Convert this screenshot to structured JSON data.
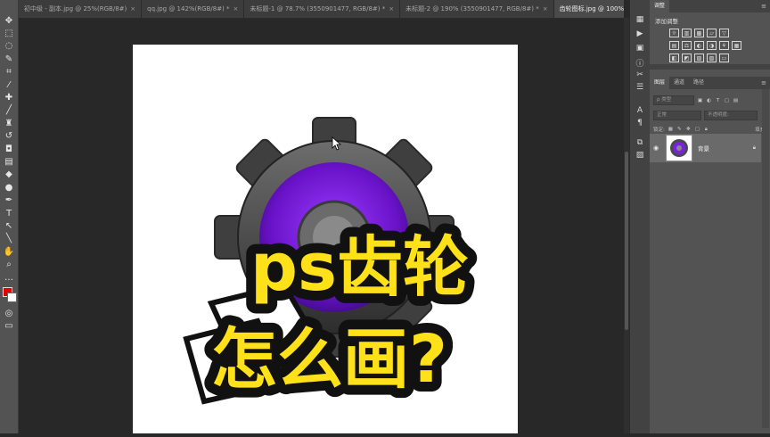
{
  "tabs": [
    {
      "label": "初中级 - 副本.jpg @ 25%(RGB/8#)",
      "active": false
    },
    {
      "label": "qq.jpg @ 142%(RGB/8#) *",
      "active": false
    },
    {
      "label": "未标题-1 @ 78.7% (3550901477, RGB/8#) *",
      "active": false
    },
    {
      "label": "未标题-2 @ 190% (3550901477, RGB/8#) *",
      "active": false
    },
    {
      "label": "齿轮图标.jpg @ 100%(RGB/8)",
      "active": true
    }
  ],
  "tools": [
    {
      "icon": "move-icon",
      "glyph": "✥"
    },
    {
      "icon": "marquee-icon",
      "glyph": "⬚"
    },
    {
      "icon": "lasso-icon",
      "glyph": "◌"
    },
    {
      "icon": "quick-select-icon",
      "glyph": "✎"
    },
    {
      "icon": "crop-icon",
      "glyph": "⌗"
    },
    {
      "icon": "eyedropper-icon",
      "glyph": "⁄"
    },
    {
      "icon": "healing-brush-icon",
      "glyph": "✚"
    },
    {
      "icon": "brush-icon",
      "glyph": "╱"
    },
    {
      "icon": "stamp-icon",
      "glyph": "♜"
    },
    {
      "icon": "history-brush-icon",
      "glyph": "↺"
    },
    {
      "icon": "eraser-icon",
      "glyph": "◘"
    },
    {
      "icon": "gradient-icon",
      "glyph": "▤"
    },
    {
      "icon": "blur-icon",
      "glyph": "◆"
    },
    {
      "icon": "dodge-icon",
      "glyph": "●"
    },
    {
      "icon": "pen-icon",
      "glyph": "✒"
    },
    {
      "icon": "type-icon",
      "glyph": "T"
    },
    {
      "icon": "path-select-icon",
      "glyph": "↖"
    },
    {
      "icon": "line-tool-icon",
      "glyph": "╲"
    },
    {
      "icon": "hand-icon",
      "glyph": "✋"
    },
    {
      "icon": "zoom-icon",
      "glyph": "⌕"
    },
    {
      "icon": "more-tools-icon",
      "glyph": "…"
    }
  ],
  "dock_icons": [
    {
      "icon": "color-panel-icon",
      "glyph": "▦"
    },
    {
      "icon": "play-icon",
      "glyph": "▶"
    },
    {
      "icon": "swatch-panel-icon",
      "glyph": "▣"
    },
    {
      "icon": "info-icon",
      "glyph": "ⓘ"
    },
    {
      "icon": "brush-settings-icon",
      "glyph": "✂"
    },
    {
      "icon": "properties-icon",
      "glyph": "☰"
    },
    {
      "icon": "character-icon",
      "glyph": "A"
    },
    {
      "icon": "paragraph-icon",
      "glyph": "¶"
    },
    {
      "icon": "layer-comps-icon",
      "glyph": "⧉"
    },
    {
      "icon": "channels-icon",
      "glyph": "▨"
    }
  ],
  "adjustments": {
    "tab_label": "调整",
    "title": "添加调整",
    "row1": [
      "☼",
      "▥",
      "▩",
      "▱",
      "▽"
    ],
    "row2": [
      "▤",
      "⚖",
      "◐",
      "◑",
      "⚘",
      "▦"
    ],
    "row3": [
      "◧",
      "◩",
      "▨",
      "▧",
      "▭"
    ]
  },
  "layers_panel": {
    "tabs": [
      "图层",
      "通道",
      "路径"
    ],
    "filter_placeholder": "ρ 类型",
    "blend_mode": "正常",
    "opacity_label": "不透明度:",
    "lock_label": "锁定:",
    "fill_label": "填充:",
    "layer_name": "背景"
  },
  "artwork": {
    "title_line1": "ps齿轮",
    "title_line2": "怎么画?"
  }
}
